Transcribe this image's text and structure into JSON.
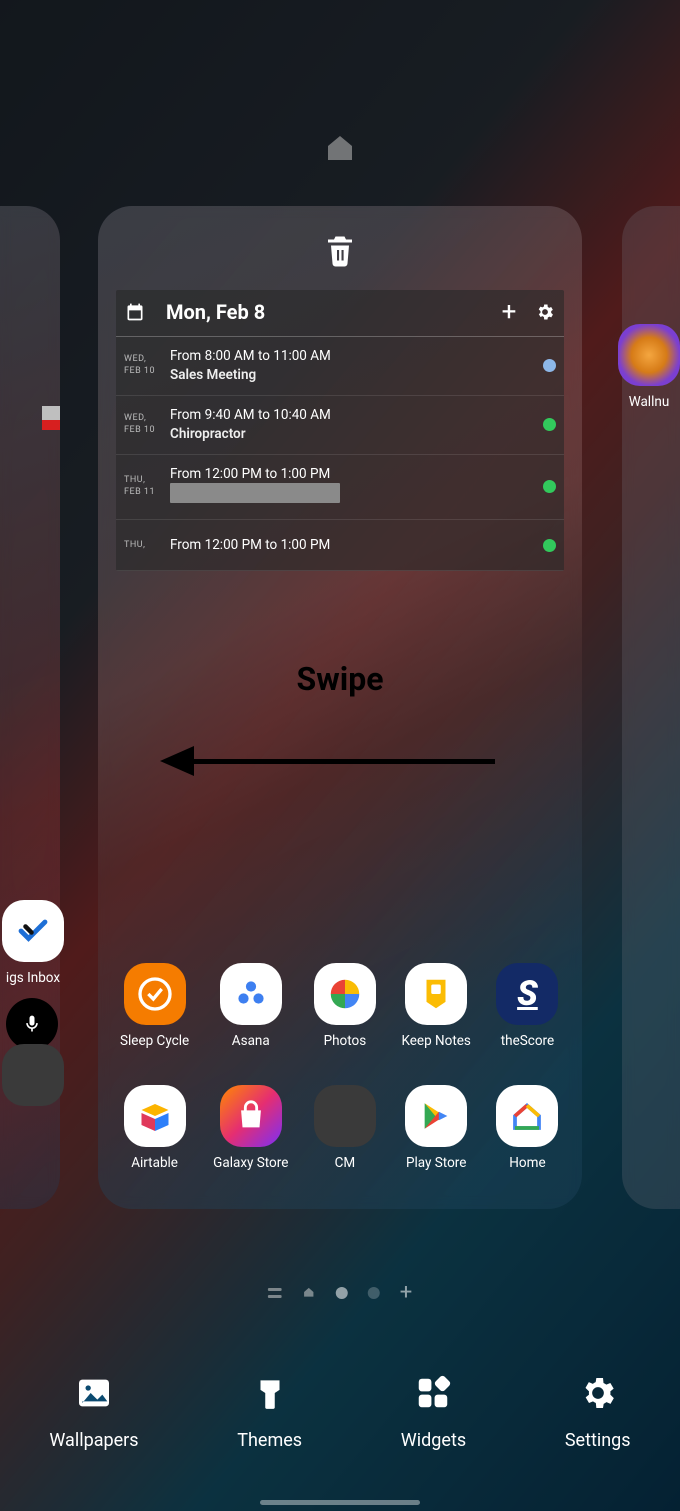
{
  "annotation": {
    "label": "Swipe"
  },
  "calendar": {
    "date": "Mon, Feb 8",
    "events": [
      {
        "day": "WED,",
        "date": "FEB 10",
        "time": "From 8:00 AM to 11:00 AM",
        "title": "Sales Meeting",
        "color": "#8db7e8"
      },
      {
        "day": "WED,",
        "date": "FEB 10",
        "time": "From 9:40 AM to 10:40 AM",
        "title": "Chiropractor",
        "color": "#32c95c"
      },
      {
        "day": "THU,",
        "date": "FEB 11",
        "time": "From 12:00 PM to 1:00 PM",
        "title": "",
        "redacted": true,
        "color": "#32c95c"
      },
      {
        "day": "THU,",
        "date": "",
        "time": "From 12:00 PM to 1:00 PM",
        "title": "",
        "color": "#32c95c"
      }
    ]
  },
  "apps_row1": [
    {
      "name": "Sleep Cycle"
    },
    {
      "name": "Asana"
    },
    {
      "name": "Photos"
    },
    {
      "name": "Keep Notes"
    },
    {
      "name": "theScore"
    }
  ],
  "apps_row2": [
    {
      "name": "Airtable"
    },
    {
      "name": "Galaxy Store"
    },
    {
      "name": "CM"
    },
    {
      "name": "Play Store"
    },
    {
      "name": "Home"
    }
  ],
  "left_edge": {
    "top_app": "igs Inbox"
  },
  "right_edge": {
    "top_app": "Wallnu"
  },
  "dock": [
    {
      "label": "Wallpapers"
    },
    {
      "label": "Themes"
    },
    {
      "label": "Widgets"
    },
    {
      "label": "Settings"
    }
  ]
}
